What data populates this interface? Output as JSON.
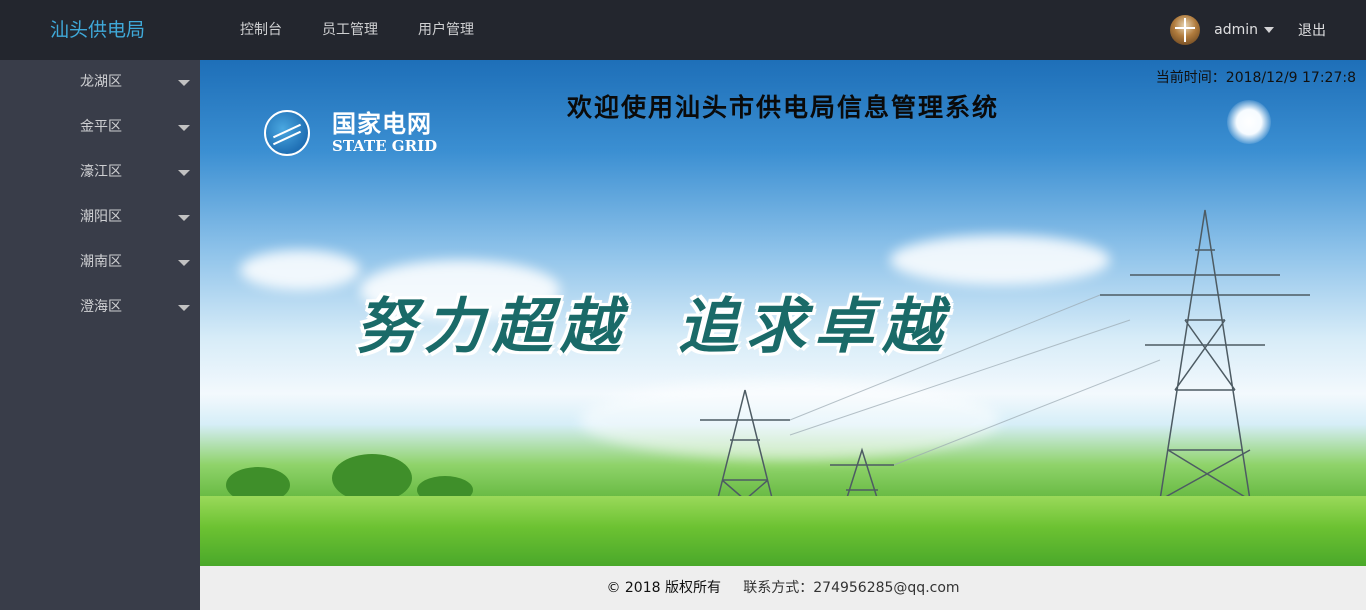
{
  "header": {
    "logo": "汕头供电局",
    "nav": [
      "控制台",
      "员工管理",
      "用户管理"
    ],
    "user_name": "admin",
    "logout_label": "退出"
  },
  "sidebar": {
    "items": [
      {
        "label": "龙湖区"
      },
      {
        "label": "金平区"
      },
      {
        "label": "濠江区"
      },
      {
        "label": "潮阳区"
      },
      {
        "label": "潮南区"
      },
      {
        "label": "澄海区"
      }
    ]
  },
  "main": {
    "welcome": "欢迎使用汕头市供电局信息管理系统",
    "time_label": "当前时间：",
    "time_value": "2018/12/9 17:27:8",
    "logo_cn": "国家电网",
    "logo_en": "STATE GRID",
    "slogan_left": "努力超越",
    "slogan_right": "追求卓越"
  },
  "footer": {
    "copyright": "© 2018 版权所有",
    "contact_label": "联系方式：",
    "contact_value": "274956285@qq.com"
  },
  "colors": {
    "header_bg": "#23262e",
    "sidebar_bg": "#393d49",
    "logo_color": "#3fa9d9",
    "footer_bg": "#eeeeee"
  },
  "icons": [
    "avatar-image",
    "chevron-down-icon",
    "state-grid-emblem-icon"
  ]
}
